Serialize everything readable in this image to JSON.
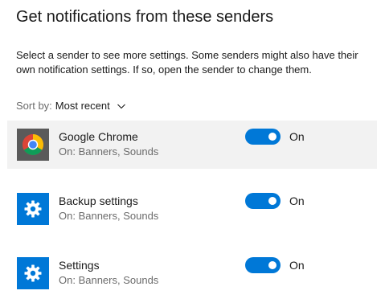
{
  "heading": "Get notifications from these senders",
  "description": "Select a sender to see more settings. Some senders might also have their own notification settings. If so, open the sender to change them.",
  "sort": {
    "label": "Sort by:",
    "value": "Most recent"
  },
  "senders": [
    {
      "name": "Google Chrome",
      "subtitle": "On: Banners, Sounds",
      "icon": "chrome-icon",
      "toggle_on": true,
      "toggle_label": "On"
    },
    {
      "name": "Backup settings",
      "subtitle": "On: Banners, Sounds",
      "icon": "gear-icon",
      "toggle_on": true,
      "toggle_label": "On"
    },
    {
      "name": "Settings",
      "subtitle": "On: Banners, Sounds",
      "icon": "gear-icon",
      "toggle_on": true,
      "toggle_label": "On"
    }
  ],
  "colors": {
    "accent": "#0078d7",
    "selected_row": "#f2f2f2",
    "secondary_text": "#6b6b6b"
  }
}
